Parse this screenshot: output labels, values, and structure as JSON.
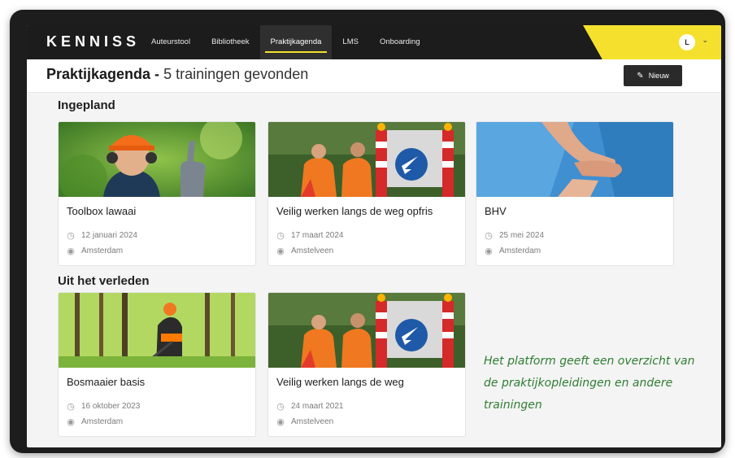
{
  "app": {
    "logo": "KENNISS",
    "avatar_initial": "L"
  },
  "nav": {
    "items": [
      "Auteurstool",
      "Bibliotheek",
      "Praktijkagenda",
      "LMS",
      "Onboarding"
    ],
    "active": "Praktijkagenda"
  },
  "page": {
    "title": "Praktijkagenda -",
    "count_text": "5 trainingen gevonden",
    "new_button": "Nieuw"
  },
  "sections": {
    "planned": "Ingepland",
    "past": "Uit het verleden"
  },
  "cards": [
    {
      "title": "Toolbox lawaai",
      "date": "12 januari 2024",
      "location": "Amsterdam",
      "image": "worker-thumbs-up"
    },
    {
      "title": "Veilig werken langs de weg opfris",
      "date": "17 maart 2024",
      "location": "Amstelveen",
      "image": "road-workers"
    },
    {
      "title": "BHV",
      "date": "25 mei 2024",
      "location": "Amsterdam",
      "image": "cpr"
    },
    {
      "title": "Bosmaaier basis",
      "date": "16 oktober 2023",
      "location": "Amsterdam",
      "image": "forest-mower"
    },
    {
      "title": "Veilig werken langs de weg",
      "date": "24 maart 2021",
      "location": "Amstelveen",
      "image": "road-workers"
    }
  ],
  "caption": {
    "lines": [
      "Het platform geeft een overzicht van",
      "de praktijkopleidingen en andere",
      "trainingen"
    ]
  },
  "colors": {
    "accent": "#f5e12d",
    "topbar": "#1c1c1c",
    "caption": "#2e7d32"
  }
}
